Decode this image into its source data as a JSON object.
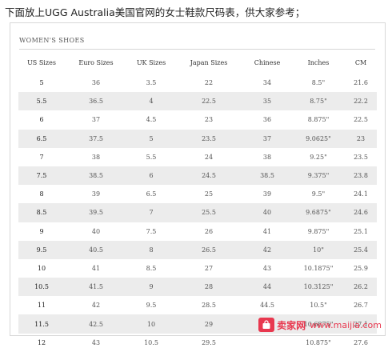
{
  "caption": "下面放上UGG Australia美国官网的女士鞋款尺码表，供大家参考；",
  "section_title": "WOMEN'S SHOES",
  "columns": [
    "US Sizes",
    "Euro Sizes",
    "UK Sizes",
    "Japan Sizes",
    "Chinese",
    "Inches",
    "CM"
  ],
  "rows": [
    [
      "5",
      "36",
      "3.5",
      "22",
      "34",
      "8.5\"",
      "21.6"
    ],
    [
      "5.5",
      "36.5",
      "4",
      "22.5",
      "35",
      "8.75\"",
      "22.2"
    ],
    [
      "6",
      "37",
      "4.5",
      "23",
      "36",
      "8.875\"",
      "22.5"
    ],
    [
      "6.5",
      "37.5",
      "5",
      "23.5",
      "37",
      "9.0625\"",
      "23"
    ],
    [
      "7",
      "38",
      "5.5",
      "24",
      "38",
      "9.25\"",
      "23.5"
    ],
    [
      "7.5",
      "38.5",
      "6",
      "24.5",
      "38.5",
      "9.375\"",
      "23.8"
    ],
    [
      "8",
      "39",
      "6.5",
      "25",
      "39",
      "9.5\"",
      "24.1"
    ],
    [
      "8.5",
      "39.5",
      "7",
      "25.5",
      "40",
      "9.6875\"",
      "24.6"
    ],
    [
      "9",
      "40",
      "7.5",
      "26",
      "41",
      "9.875\"",
      "25.1"
    ],
    [
      "9.5",
      "40.5",
      "8",
      "26.5",
      "42",
      "10\"",
      "25.4"
    ],
    [
      "10",
      "41",
      "8.5",
      "27",
      "43",
      "10.1875\"",
      "25.9"
    ],
    [
      "10.5",
      "41.5",
      "9",
      "28",
      "44",
      "10.3125\"",
      "26.2"
    ],
    [
      "11",
      "42",
      "9.5",
      "28.5",
      "44.5",
      "10.5\"",
      "26.7"
    ],
    [
      "11.5",
      "42.5",
      "10",
      "29",
      "45",
      "10.6875\"",
      "27.1"
    ],
    [
      "12",
      "43",
      "10.5",
      "29.5",
      "",
      "10.875\"",
      "27.6"
    ]
  ],
  "watermark": {
    "text": "卖家网",
    "url": "www.maijia.com",
    "color": "#e8384f"
  }
}
